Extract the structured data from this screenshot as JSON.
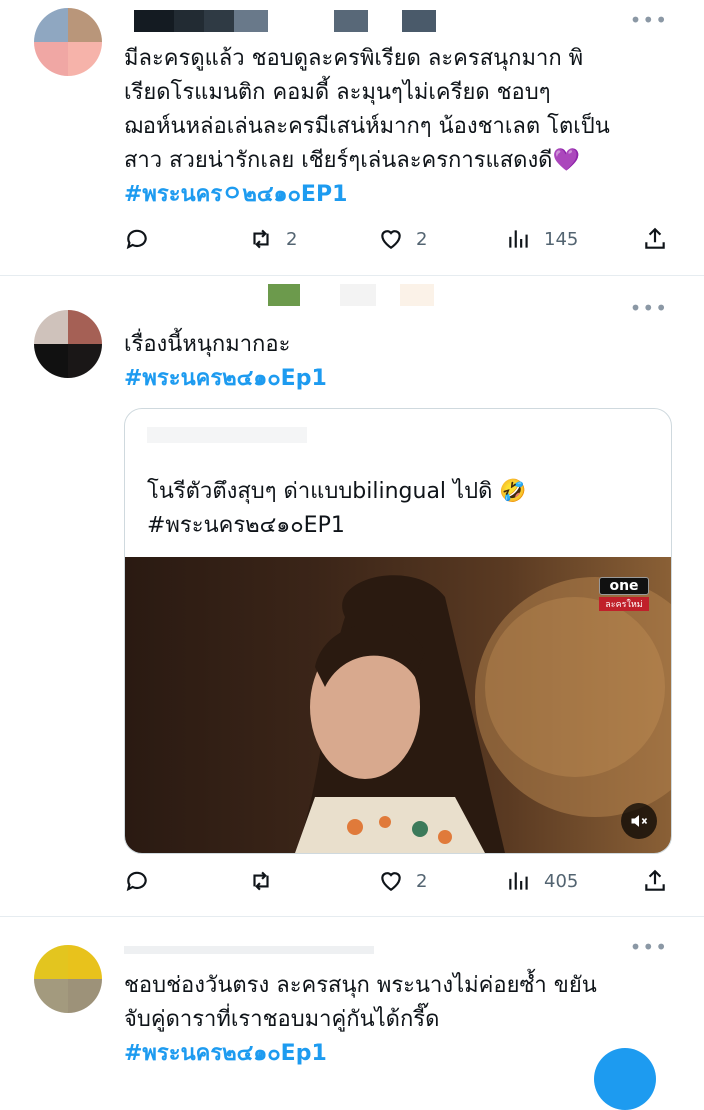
{
  "tweets": [
    {
      "text_lines": [
        "มีละครดูแล้ว ชอบดูละครพิเรียด ละครสนุกมาก พิ",
        "เรียดโรแมนติก คอมดี้ ละมุนๆไม่เครียด ชอบๆ",
        "ฌอห์นหล่อเล่นละครมีเสน่ห์มากๆ น้องชาเลต โตเป็น",
        "สาว สวยน่ารักเลย เชียร์ๆเล่นละครการแสดงดี💜"
      ],
      "hashtag": "#พระนครㅇ๒๔๑๐EP1",
      "stats": {
        "replies": "",
        "retweets": "2",
        "likes": "2",
        "views": "145"
      }
    },
    {
      "text_lines": [
        "เรื่องนี้หนุกมากอะ"
      ],
      "hashtag": "#พระนคร๒๔๑๐Ep1",
      "quote": {
        "text": "โนรีตัวตึงสุบๆ ด่าแบบbilingual ไปดิ 🤣",
        "hashtag": "#พระนคร๒๔๑๐EP1",
        "media_logo": "one",
        "media_logo_sub": "ละครใหม่"
      },
      "stats": {
        "replies": "",
        "retweets": "",
        "likes": "2",
        "views": "405"
      }
    },
    {
      "text_lines": [
        "ชอบช่องวันตรง ละครสนุก พระนางไม่ค่อยซ้ำ ขยัน",
        "จับคู่ดาราที่เราชอบมาคู่กันได้กรี๊ด"
      ],
      "hashtag": "#พระนคร๒๔๑๐Ep1",
      "stats": {}
    }
  ],
  "icons": {
    "more": "more-icon",
    "reply": "reply-icon",
    "retweet": "retweet-icon",
    "like": "heart-icon",
    "views": "views-icon",
    "share": "share-icon",
    "mute": "mute-icon"
  },
  "colors": {
    "accent": "#1d9bf0",
    "muted": "#536471",
    "text": "#0f1419"
  }
}
